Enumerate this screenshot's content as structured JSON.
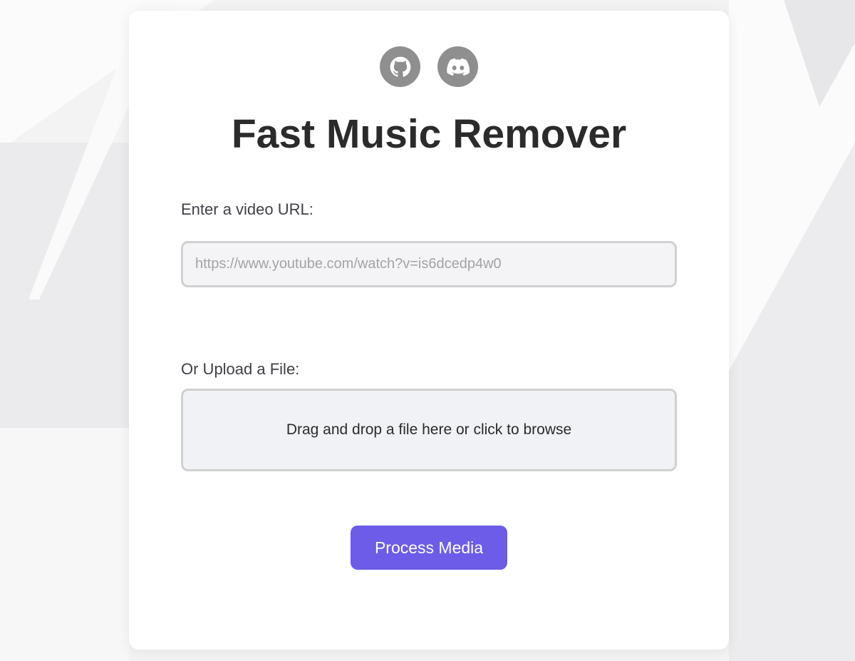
{
  "header": {
    "links": [
      {
        "icon": "github-icon",
        "label": "GitHub"
      },
      {
        "icon": "discord-icon",
        "label": "Discord"
      }
    ],
    "title": "Fast Music Remover"
  },
  "url_section": {
    "label": "Enter a video URL:",
    "placeholder": "https://www.youtube.com/watch?v=is6dcedp4w0",
    "value": ""
  },
  "upload_section": {
    "label": "Or Upload a File:",
    "dropzone_text": "Drag and drop a file here or click to browse"
  },
  "actions": {
    "process_label": "Process Media"
  },
  "colors": {
    "accent": "#6c5ce7",
    "icon_circle": "#8f8f8f",
    "title_text": "#2b2b2b",
    "input_border": "#d0d0d0"
  }
}
